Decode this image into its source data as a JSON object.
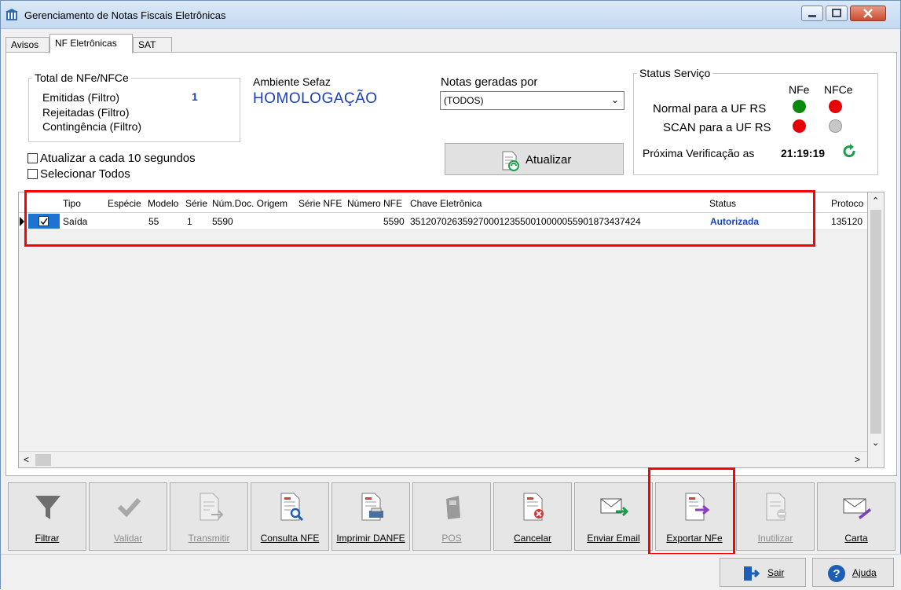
{
  "window": {
    "title": "Gerenciamento de Notas Fiscais Eletrônicas"
  },
  "tabs": [
    {
      "label": "Avisos"
    },
    {
      "label": "NF Eletrônicas"
    },
    {
      "label": "SAT"
    }
  ],
  "totals": {
    "title": "Total de NFe/NFCe",
    "emitidas_label": "Emitidas (Filtro)",
    "emitidas_value": "1",
    "rejeitadas_label": "Rejeitadas (Filtro)",
    "contingencia_label": "Contingência (Filtro)"
  },
  "ambiente": {
    "label": "Ambiente Sefaz",
    "value": "HOMOLOGAÇÃO"
  },
  "notas": {
    "label": "Notas geradas por",
    "selected": "(TODOS)"
  },
  "options": {
    "auto_refresh_label": "Atualizar a cada 10 segundos",
    "select_all_label": "Selecionar Todos"
  },
  "refresh_button": {
    "label": "Atualizar"
  },
  "status_servico": {
    "title": "Status Serviço",
    "col_nfe": "NFe",
    "col_nfce": "NFCe",
    "row1_label": "Normal para a UF RS",
    "row2_label": "SCAN para a UF RS",
    "next_check_label": "Próxima Verificação as",
    "next_check_time": "21:19:19",
    "colors": {
      "green": "#0a8a0a",
      "red": "#e60000",
      "gray": "#c8c8c8"
    }
  },
  "grid": {
    "headers": [
      "Tipo",
      "Espécie",
      "Modelo",
      "Série",
      "Núm.Doc. Origem",
      "Série NFE",
      "Número NFE",
      "Chave Eletrônica",
      "Status",
      "Protoco"
    ],
    "row": {
      "tipo": "Saída",
      "especie": "",
      "modelo": "55",
      "serie": "1",
      "num_doc_origem": "5590",
      "serie_nfe": "",
      "numero_nfe": "5590",
      "chave": "35120702635927000123550010000055901873437424",
      "status": "Autorizada",
      "protocolo": "135120"
    }
  },
  "toolbar": [
    {
      "label": "Filtrar",
      "icon": "filter-icon",
      "enabled": true
    },
    {
      "label": "Validar",
      "icon": "check-icon",
      "enabled": false
    },
    {
      "label": "Transmitir",
      "icon": "transmit-document-icon",
      "enabled": false
    },
    {
      "label": "Consulta NFE",
      "icon": "search-document-icon",
      "enabled": true
    },
    {
      "label": "Imprimir DANFE",
      "icon": "print-document-icon",
      "enabled": true
    },
    {
      "label": "POS",
      "icon": "pos-terminal-icon",
      "enabled": false
    },
    {
      "label": "Cancelar",
      "icon": "cancel-document-icon",
      "enabled": true
    },
    {
      "label": "Enviar Email",
      "icon": "send-email-icon",
      "enabled": true
    },
    {
      "label": "Exportar NFe",
      "icon": "export-document-icon",
      "enabled": true
    },
    {
      "label": "Inutilizar",
      "icon": "void-document-icon",
      "enabled": false
    },
    {
      "label": "Carta",
      "icon": "letter-icon",
      "enabled": true
    }
  ],
  "footer": {
    "exit_label": "Sair",
    "help_label": "Ajuda"
  }
}
